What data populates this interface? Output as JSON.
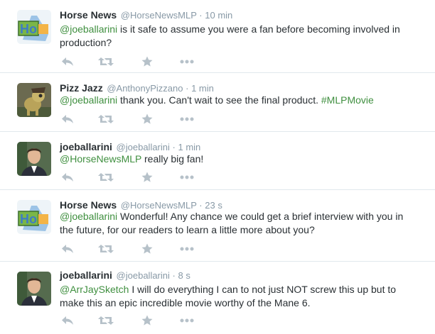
{
  "tweets": [
    {
      "fullname": "Horse News",
      "username": "@HorseNewsMLP",
      "separator": "·",
      "time": "10 min",
      "mention": "@joeballarini",
      "text": " is it safe to assume you were a fan before becoming involved in production?",
      "avatar_icon": "horse-news-logo"
    },
    {
      "fullname": "Pizz Jazz",
      "username": "@AnthonyPizzano",
      "separator": "·",
      "time": "1 min",
      "mention": "@joeballarini",
      "text": " thank you. Can't wait to see the final product. ",
      "hashtag": "#MLPMovie",
      "avatar_icon": "pony-avatar"
    },
    {
      "fullname": "joeballarini",
      "username": "@joeballarini",
      "separator": "·",
      "time": "1 min",
      "mention": "@HorseNewsMLP",
      "text": " really big fan!",
      "avatar_icon": "person-avatar"
    },
    {
      "fullname": "Horse News",
      "username": "@HorseNewsMLP",
      "separator": "·",
      "time": "23 s",
      "mention": "@joeballarini",
      "text": " Wonderful! Any chance we could get a brief interview with you in the future, for our readers to learn a little more about you?",
      "avatar_icon": "horse-news-logo"
    },
    {
      "fullname": "joeballarini",
      "username": "@joeballarini",
      "separator": "·",
      "time": "8 s",
      "mention": "@ArrJaySketch",
      "text": " I will do everything I can to not just NOT screw this up but to make this an epic incredible movie worthy of the Mane 6.",
      "avatar_icon": "person-avatar"
    }
  ],
  "colors": {
    "link": "#3f8f3f",
    "meta": "#8899a6",
    "action_icon": "#b6c1c9",
    "divider": "#e1e8ed"
  }
}
